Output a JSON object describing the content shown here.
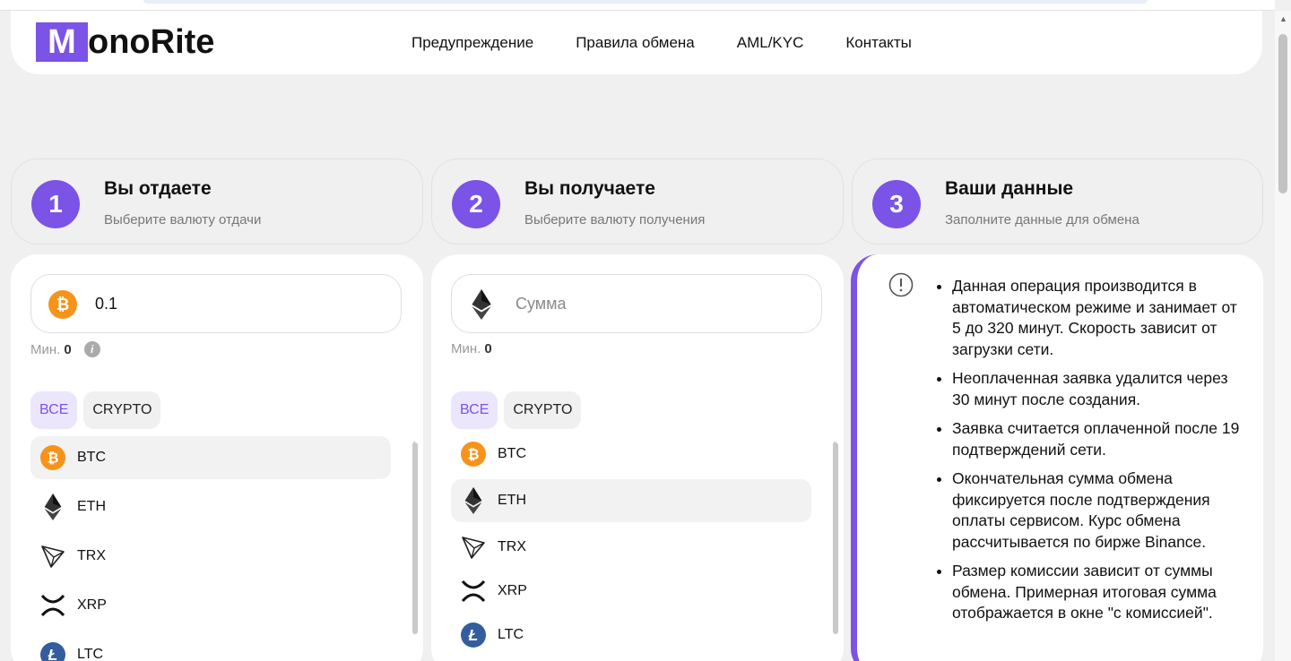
{
  "header": {
    "logo_letter": "M",
    "logo_text": "onoRite",
    "nav": [
      "Предупреждение",
      "Правила обмена",
      "AML/KYC",
      "Контакты"
    ]
  },
  "steps": [
    {
      "num": "1",
      "title": "Вы отдаете",
      "subtitle": "Выберите валюту отдачи"
    },
    {
      "num": "2",
      "title": "Вы получаете",
      "subtitle": "Выберите валюту получения"
    },
    {
      "num": "3",
      "title": "Ваши данные",
      "subtitle": "Заполните данные для обмена"
    }
  ],
  "give": {
    "amount_value": "0.1",
    "min_label": "Мин.",
    "min_value": "0",
    "info_glyph": "i",
    "filters": [
      "ВСЕ",
      "CRYPTO"
    ],
    "coins": [
      "BTC",
      "ETH",
      "TRX",
      "XRP",
      "LTC"
    ],
    "selected": "BTC"
  },
  "receive": {
    "amount_placeholder": "Сумма",
    "min_label": "Мин.",
    "min_value": "0",
    "filters": [
      "ВСЕ",
      "CRYPTO"
    ],
    "coins": [
      "BTC",
      "ETH",
      "TRX",
      "XRP",
      "LTC"
    ],
    "selected": "ETH"
  },
  "notice": {
    "items": [
      "Данная операция производится в автоматическом режиме и занимает от 5 до 320 минут. Скорость зависит от загрузки сети.",
      "Неоплаченная заявка удалится через 30 минут после создания.",
      "Заявка считается оплаченной после 19 подтверждений сети.",
      "Окончательная сумма обмена фиксируется после подтверждения оплаты сервисом. Курс обмена рассчитывается по бирже Binance.",
      "Размер комиссии зависит от суммы обмена. Примерная итоговая сумма отображается в окне \"с комиссией\"."
    ]
  },
  "colors": {
    "accent": "#7b53e6",
    "btc": "#f7931a",
    "ltc": "#345d9d",
    "background": "#f0f0f0"
  }
}
